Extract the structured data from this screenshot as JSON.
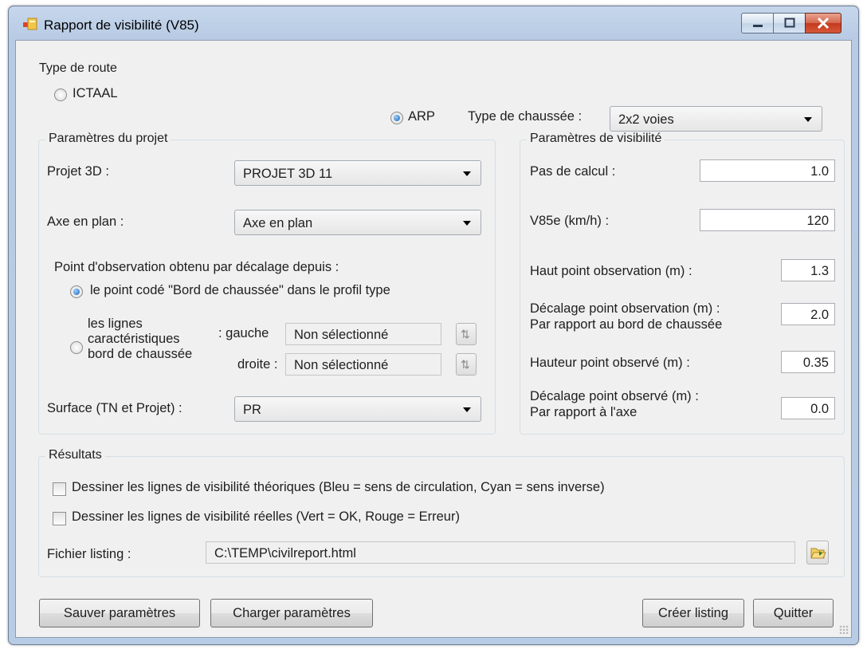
{
  "window": {
    "title": "Rapport de visibilité (V85)"
  },
  "type_route": {
    "group_title": "Type de route",
    "option_ictaal": "ICTAAL",
    "option_arp": "ARP",
    "selected": "ARP",
    "chaussee_label": "Type de chaussée :",
    "chaussee_value": "2x2 voies"
  },
  "projet": {
    "group_title": "Paramètres du projet",
    "projet3d_label": "Projet 3D :",
    "projet3d_value": "PROJET 3D 11",
    "axe_label": "Axe en plan :",
    "axe_value": "Axe en plan",
    "point_obs_label": "Point d'observation obtenu par décalage depuis :",
    "option_point_code": "le point codé \"Bord de chaussée\" dans le profil type",
    "option_lignes_1": "les lignes",
    "option_lignes_2": "caractéristiques",
    "option_lignes_3": "bord de chaussée",
    "gauche_label": "gauche :",
    "gauche_value": "Non sélectionné",
    "droite_label": "droite :",
    "droite_value": "Non sélectionné",
    "surface_label": "Surface (TN et Projet) :",
    "surface_value": "PR"
  },
  "visibilite": {
    "group_title": "Paramètres de visibilité",
    "pas_label": "Pas de calcul :",
    "pas_value": "1.0",
    "v85_label": "V85e (km/h) :",
    "v85_value": "120",
    "haut_obs_label": "Haut point observation (m) :",
    "haut_obs_value": "1.3",
    "decal_obs_label_1": "Décalage point observation (m) :",
    "decal_obs_label_2": "Par rapport au bord de chaussée",
    "decal_obs_value": "2.0",
    "hauteur_observe_label": "Hauteur point observé (m) :",
    "hauteur_observe_value": "0.35",
    "decal_observe_label_1": "Décalage point observé (m) :",
    "decal_observe_label_2": "Par rapport à l'axe",
    "decal_observe_value": "0.0"
  },
  "resultats": {
    "group_title": "Résultats",
    "check_theoriques": "Dessiner les lignes de visibilité théoriques (Bleu = sens de circulation, Cyan = sens inverse)",
    "check_reelles": "Dessiner les lignes de visibilité réelles (Vert = OK, Rouge = Erreur)",
    "fichier_label": "Fichier listing :",
    "fichier_value": "C:\\TEMP\\civilreport.html"
  },
  "buttons": {
    "sauver": "Sauver paramètres",
    "charger": "Charger paramètres",
    "creer": "Créer listing",
    "quitter": "Quitter"
  }
}
